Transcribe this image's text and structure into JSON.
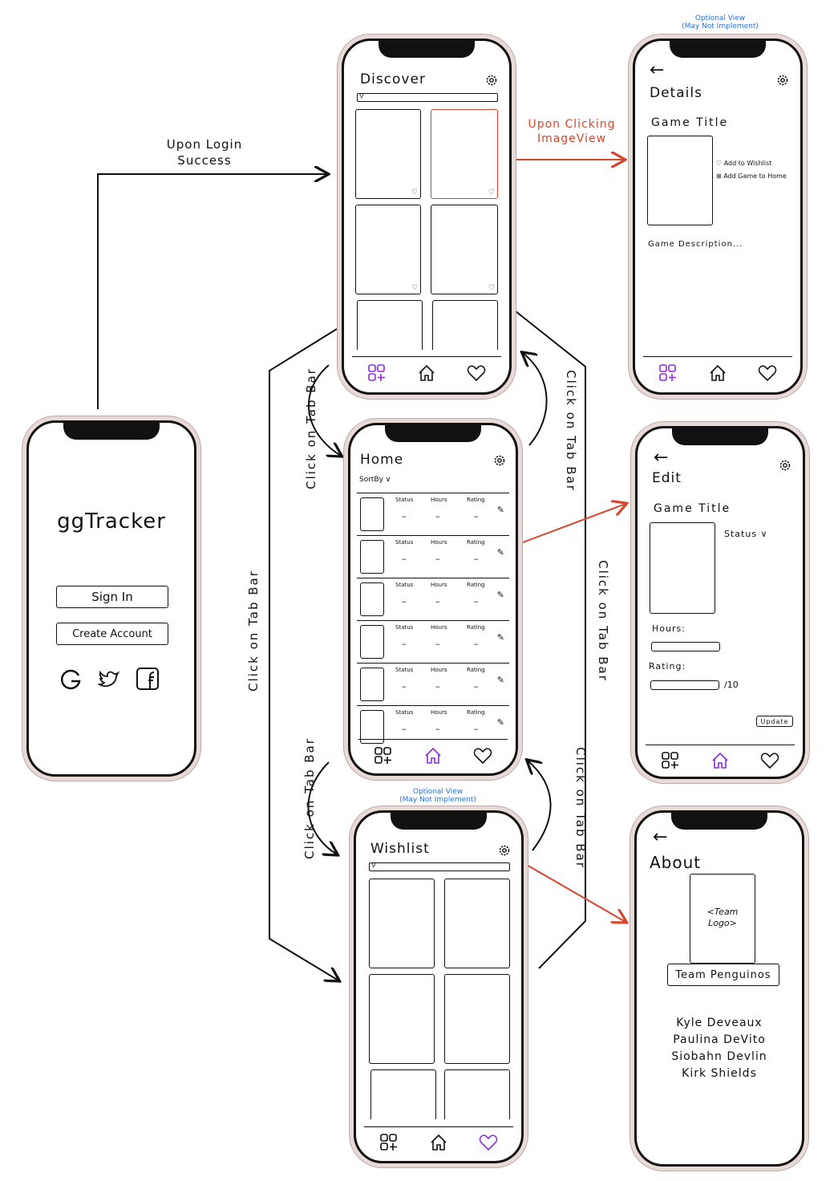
{
  "colors": {
    "ink": "#111111",
    "accent_purple": "#8a2be2",
    "annotation_red": "#d5462f",
    "note_blue": "#2f6fd6"
  },
  "login": {
    "app_title": "ggTracker",
    "sign_in_label": "Sign In",
    "create_account_label": "Create Account",
    "social_icons": [
      "google-icon",
      "twitter-icon",
      "facebook-icon"
    ]
  },
  "discover": {
    "title": "Discover",
    "active_tab": "discover"
  },
  "home": {
    "title": "Home",
    "sort_label": "SortBy ∨",
    "columns": [
      "Status",
      "Hours",
      "Rating"
    ],
    "empty_value": "–",
    "row_count": 6,
    "active_tab": "home"
  },
  "wishlist": {
    "title": "Wishlist",
    "optional_note": {
      "line1": "Optional View",
      "line2": "(May Not Implement)"
    },
    "active_tab": "wishlist"
  },
  "details": {
    "optional_note": {
      "line1": "Optional View",
      "line2": "(May Not Implement)"
    },
    "back_arrow": "←",
    "title": "Details",
    "game_title": "Game Title",
    "add_wishlist": "Add to Wishlist",
    "add_home": "Add Game to Home",
    "description": "Game Description..."
  },
  "edit": {
    "back_arrow": "←",
    "title": "Edit",
    "game_title": "Game Title",
    "status_label": "Status ∨",
    "hours_label": "Hours:",
    "rating_label": "Rating:",
    "rating_suffix": "/10",
    "update_label": "Update"
  },
  "about": {
    "back_arrow": "←",
    "title": "About",
    "logo_placeholder": "<Team Logo>",
    "team_name": "Team Penguinos",
    "members": [
      "Kyle Deveaux",
      "Paulina DeVito",
      "Siobahn Devlin",
      "Kirk Shields"
    ]
  },
  "annotations": {
    "login_success": "Upon Login Success",
    "click_image": "Upon Clicking ImageView",
    "click_tab_bar": "Click on Tab Bar"
  }
}
